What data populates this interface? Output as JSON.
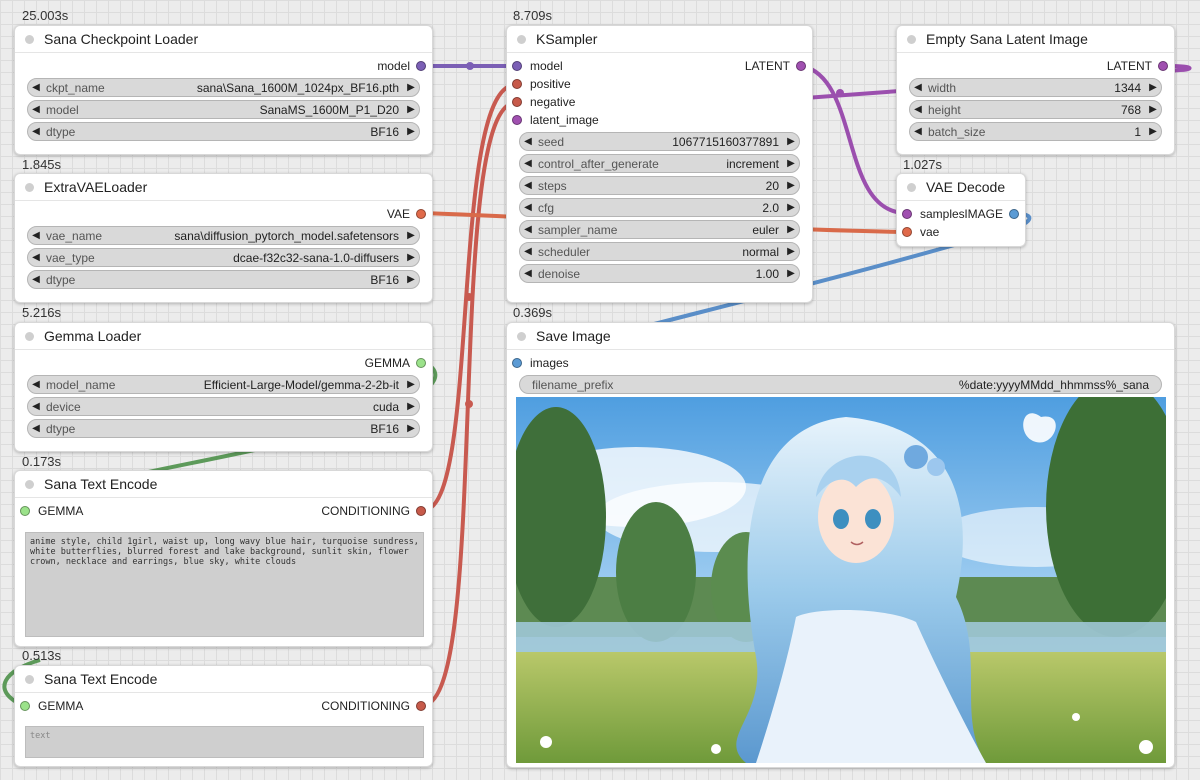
{
  "timings": {
    "checkpoint": "25.003s",
    "ksampler": "8.709s",
    "vae_loader": "1.845s",
    "vae_decode": "1.027s",
    "gemma_loader": "5.216s",
    "save_image": "0.369s",
    "text_encode_1": "0.173s",
    "text_encode_2": "0.513s"
  },
  "nodes": {
    "checkpoint": {
      "title": "Sana Checkpoint Loader",
      "output": "model",
      "widgets": [
        {
          "name": "ckpt_name",
          "value": "sana\\Sana_1600M_1024px_BF16.pth"
        },
        {
          "name": "model",
          "value": "SanaMS_1600M_P1_D20"
        },
        {
          "name": "dtype",
          "value": "BF16"
        }
      ]
    },
    "vae_loader": {
      "title": "ExtraVAELoader",
      "output": "VAE",
      "widgets": [
        {
          "name": "vae_name",
          "value": "sana\\diffusion_pytorch_model.safetensors"
        },
        {
          "name": "vae_type",
          "value": "dcae-f32c32-sana-1.0-diffusers"
        },
        {
          "name": "dtype",
          "value": "BF16"
        }
      ]
    },
    "gemma_loader": {
      "title": "Gemma Loader",
      "output": "GEMMA",
      "widgets": [
        {
          "name": "model_name",
          "value": "Efficient-Large-Model/gemma-2-2b-it"
        },
        {
          "name": "device",
          "value": "cuda"
        },
        {
          "name": "dtype",
          "value": "BF16"
        }
      ]
    },
    "text_encode_1": {
      "title": "Sana Text Encode",
      "input": "GEMMA",
      "output": "CONDITIONING",
      "text": "anime style, child 1girl, waist up, long wavy blue hair, turquoise sundress, white butterflies, blurred forest and lake background, sunlit skin, flower crown, necklace and earrings, blue sky, white clouds"
    },
    "text_encode_2": {
      "title": "Sana Text Encode",
      "input": "GEMMA",
      "output": "CONDITIONING",
      "placeholder": "text"
    },
    "ksampler": {
      "title": "KSampler",
      "inputs": [
        "model",
        "positive",
        "negative",
        "latent_image"
      ],
      "output": "LATENT",
      "widgets": [
        {
          "name": "seed",
          "value": "1067715160377891"
        },
        {
          "name": "control_after_generate",
          "value": "increment"
        },
        {
          "name": "steps",
          "value": "20"
        },
        {
          "name": "cfg",
          "value": "2.0"
        },
        {
          "name": "sampler_name",
          "value": "euler"
        },
        {
          "name": "scheduler",
          "value": "normal"
        },
        {
          "name": "denoise",
          "value": "1.00"
        }
      ]
    },
    "empty_latent": {
      "title": "Empty Sana Latent Image",
      "output": "LATENT",
      "widgets": [
        {
          "name": "width",
          "value": "1344"
        },
        {
          "name": "height",
          "value": "768"
        },
        {
          "name": "batch_size",
          "value": "1"
        }
      ]
    },
    "vae_decode": {
      "title": "VAE Decode",
      "inputs": [
        "samples",
        "vae"
      ],
      "output": "IMAGE"
    },
    "save_image": {
      "title": "Save Image",
      "input": "images",
      "widget": {
        "name": "filename_prefix",
        "value": "%date:yyyyMMdd_hhmmss%_sana"
      }
    }
  },
  "colors": {
    "model": "#7b5fb5",
    "conditioning": "#c75a4a",
    "vae": "#e06a4a",
    "gemma": "#7ccb6a",
    "latent": "#a050b0",
    "image": "#5b9bd5",
    "wire_red": "#c85a50",
    "wire_purple": "#8f55a8",
    "wire_green": "#5d9a5a",
    "wire_blue": "#5a8ec8"
  },
  "icons": {
    "left_arrow": "left-triangle-icon",
    "right_arrow": "right-triangle-icon"
  }
}
